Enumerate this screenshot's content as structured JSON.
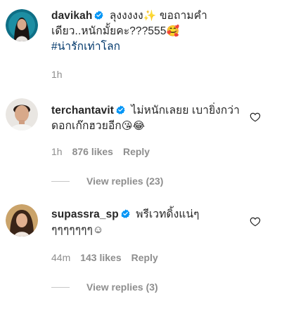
{
  "caption": {
    "username": "davikah",
    "text_before_emoji": " ลุงงงงง",
    "sparkle_emoji": "✨",
    "text_after_emoji": " ขอถามคำเดียว..หนักมั้ยคะ???555",
    "smile_emoji": "🥰",
    "hashtag": "#น่ารักเท่าโลก",
    "time": "1h"
  },
  "comments": [
    {
      "username": "terchantavit",
      "text": " ไม่หนักเลยย เบายิ่งกว่าดอกเก๊กฮวยอีก",
      "emoji_1": "😘",
      "emoji_2": "😂",
      "time": "1h",
      "likes": "876 likes",
      "reply": "Reply",
      "view_replies": "View replies (23)"
    },
    {
      "username": "supassra_sp",
      "text": " พรีเวทดิ้งแน่ๆ ๆๆๆๆๆๆๆ",
      "emoji_1": "☺",
      "time": "44m",
      "likes": "143 likes",
      "reply": "Reply",
      "view_replies": "View replies (3)"
    }
  ],
  "icons": {
    "verified": "verified-badge-icon",
    "like": "heart-outline-icon"
  },
  "colors": {
    "verified_blue": "#0095f6",
    "hashtag": "#00376b",
    "meta_gray": "#8e8e8e"
  }
}
